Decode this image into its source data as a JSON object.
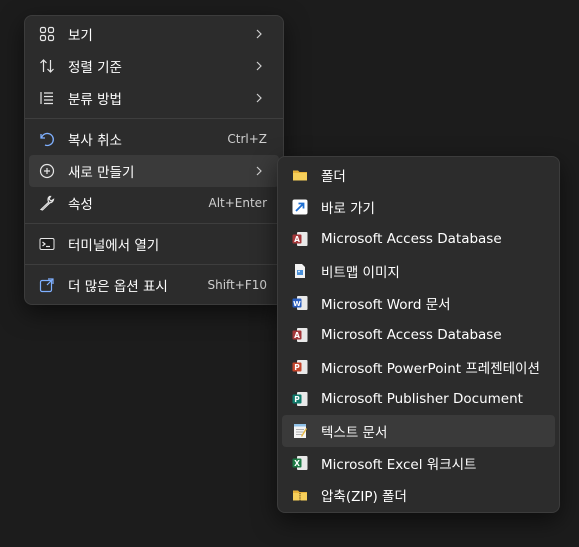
{
  "main_menu": {
    "items": [
      {
        "label": "보기",
        "icon": "grid-icon",
        "submenu": true
      },
      {
        "label": "정렬 기준",
        "icon": "sort-icon",
        "submenu": true
      },
      {
        "label": "분류 방법",
        "icon": "group-list-icon",
        "submenu": true
      },
      {
        "label": "복사 취소",
        "icon": "undo-icon",
        "shortcut": "Ctrl+Z"
      },
      {
        "label": "새로 만들기",
        "icon": "new-plus-icon",
        "submenu": true
      },
      {
        "label": "속성",
        "icon": "wrench-icon",
        "shortcut": "Alt+Enter"
      },
      {
        "label": "터미널에서 열기",
        "icon": "terminal-icon"
      },
      {
        "label": "더 많은 옵션 표시",
        "icon": "more-options-icon",
        "shortcut": "Shift+F10"
      }
    ]
  },
  "sub_menu": {
    "items": [
      {
        "label": "폴더",
        "icon": "folder-icon"
      },
      {
        "label": "바로 가기",
        "icon": "shortcut-arrow-icon"
      },
      {
        "label": "Microsoft Access Database",
        "icon": "access-icon"
      },
      {
        "label": "비트맵 이미지",
        "icon": "bitmap-icon"
      },
      {
        "label": "Microsoft Word 문서",
        "icon": "word-icon"
      },
      {
        "label": "Microsoft Access Database",
        "icon": "access-icon"
      },
      {
        "label": "Microsoft PowerPoint 프레젠테이션",
        "icon": "powerpoint-icon"
      },
      {
        "label": "Microsoft Publisher Document",
        "icon": "publisher-icon"
      },
      {
        "label": "텍스트 문서",
        "icon": "notepad-icon"
      },
      {
        "label": "Microsoft Excel 워크시트",
        "icon": "excel-icon"
      },
      {
        "label": "압축(ZIP) 폴더",
        "icon": "zip-folder-icon"
      }
    ]
  },
  "colors": {
    "menu_bg": "#2c2c2c",
    "hover_bg": "#3a3a3a",
    "word": "#2b5fc0",
    "excel": "#1d7a45",
    "powerpoint": "#c4452b",
    "access": "#a4373a",
    "publisher": "#0f7b6c",
    "folder": "#f2c54e"
  }
}
